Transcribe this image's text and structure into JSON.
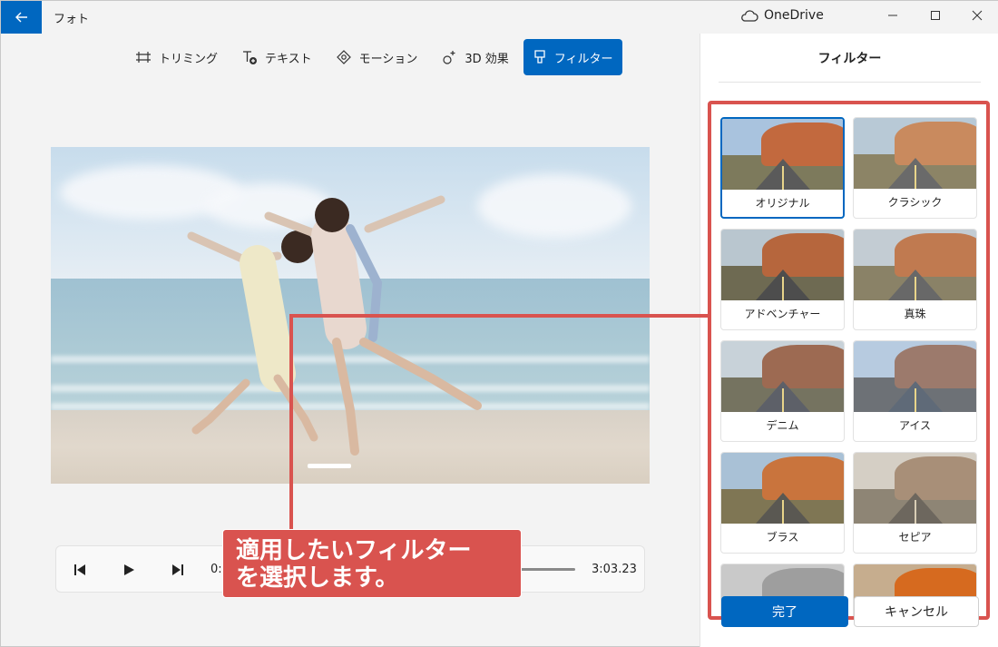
{
  "app": {
    "title": "フォト",
    "cloud_label": "OneDrive"
  },
  "toolbar": {
    "items": [
      {
        "label": "トリミング",
        "icon": "crop-icon"
      },
      {
        "label": "テキスト",
        "icon": "text-add-icon"
      },
      {
        "label": "モーション",
        "icon": "motion-icon"
      },
      {
        "label": "3D 効果",
        "icon": "sparkle-3d-icon"
      },
      {
        "label": "フィルター",
        "icon": "filter-brush-icon",
        "active": true
      }
    ]
  },
  "playback": {
    "time_current": "0:",
    "time_total": "3:03.23"
  },
  "callout": {
    "line1": "適用したいフィルター",
    "line2": "を選択します。"
  },
  "panel": {
    "title": "フィルター",
    "filters": [
      {
        "label": "オリジナル",
        "selected": true
      },
      {
        "label": "クラシック"
      },
      {
        "label": "アドベンチャー"
      },
      {
        "label": "真珠"
      },
      {
        "label": "デニム"
      },
      {
        "label": "アイス"
      },
      {
        "label": "ブラス"
      },
      {
        "label": "セピア"
      }
    ],
    "done_label": "完了",
    "cancel_label": "キャンセル"
  },
  "colors": {
    "accent": "#0067c0",
    "callout": "#d9534f"
  }
}
